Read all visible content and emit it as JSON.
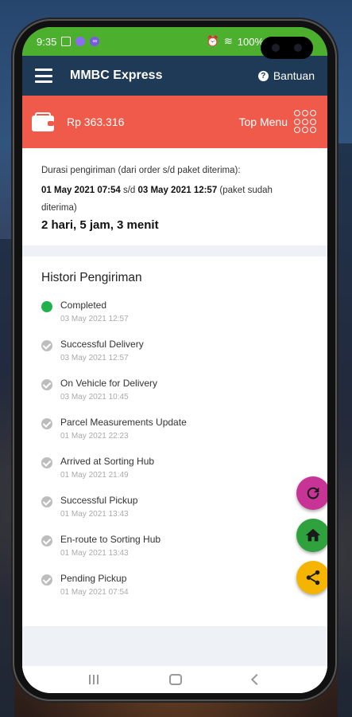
{
  "status_bar": {
    "time": "9:35",
    "battery": "100%"
  },
  "app_bar": {
    "title": "MMBC Express",
    "help_label": "Bantuan"
  },
  "wallet": {
    "balance": "Rp 363.316",
    "menu_label": "Top Menu"
  },
  "duration": {
    "label": "Durasi pengiriman (dari order s/d paket diterima):",
    "start": "01 May 2021 07:54",
    "separator": " s/d ",
    "end": "03 May 2021 12:57",
    "note": " (paket sudah diterima)",
    "total": "2 hari, 5 jam, 3 menit"
  },
  "history": {
    "title": "Histori Pengiriman",
    "steps": [
      {
        "status": "Completed",
        "time": "03 May 2021 12:57"
      },
      {
        "status": "Successful Delivery",
        "time": "03 May 2021 12:57"
      },
      {
        "status": "On Vehicle for Delivery",
        "time": "03 May 2021 10:45"
      },
      {
        "status": "Parcel Measurements Update",
        "time": "01 May 2021 22:23"
      },
      {
        "status": "Arrived at Sorting Hub",
        "time": "01 May 2021 21:49"
      },
      {
        "status": "Successful Pickup",
        "time": "01 May 2021 13:43"
      },
      {
        "status": "En-route to Sorting Hub",
        "time": "01 May 2021 13:43"
      },
      {
        "status": "Pending Pickup",
        "time": "01 May 2021 07:54"
      }
    ]
  },
  "fabs": {
    "refresh_icon": "refresh-icon",
    "home_icon": "home-icon",
    "share_icon": "share-icon"
  },
  "colors": {
    "status_bar": "#4caf2e",
    "app_bar": "#1e3a56",
    "wallet_bar": "#f05a4a",
    "completed": "#22b14c",
    "fab_refresh": "#c83396",
    "fab_home": "#2fa23d",
    "fab_share": "#f5b400"
  }
}
